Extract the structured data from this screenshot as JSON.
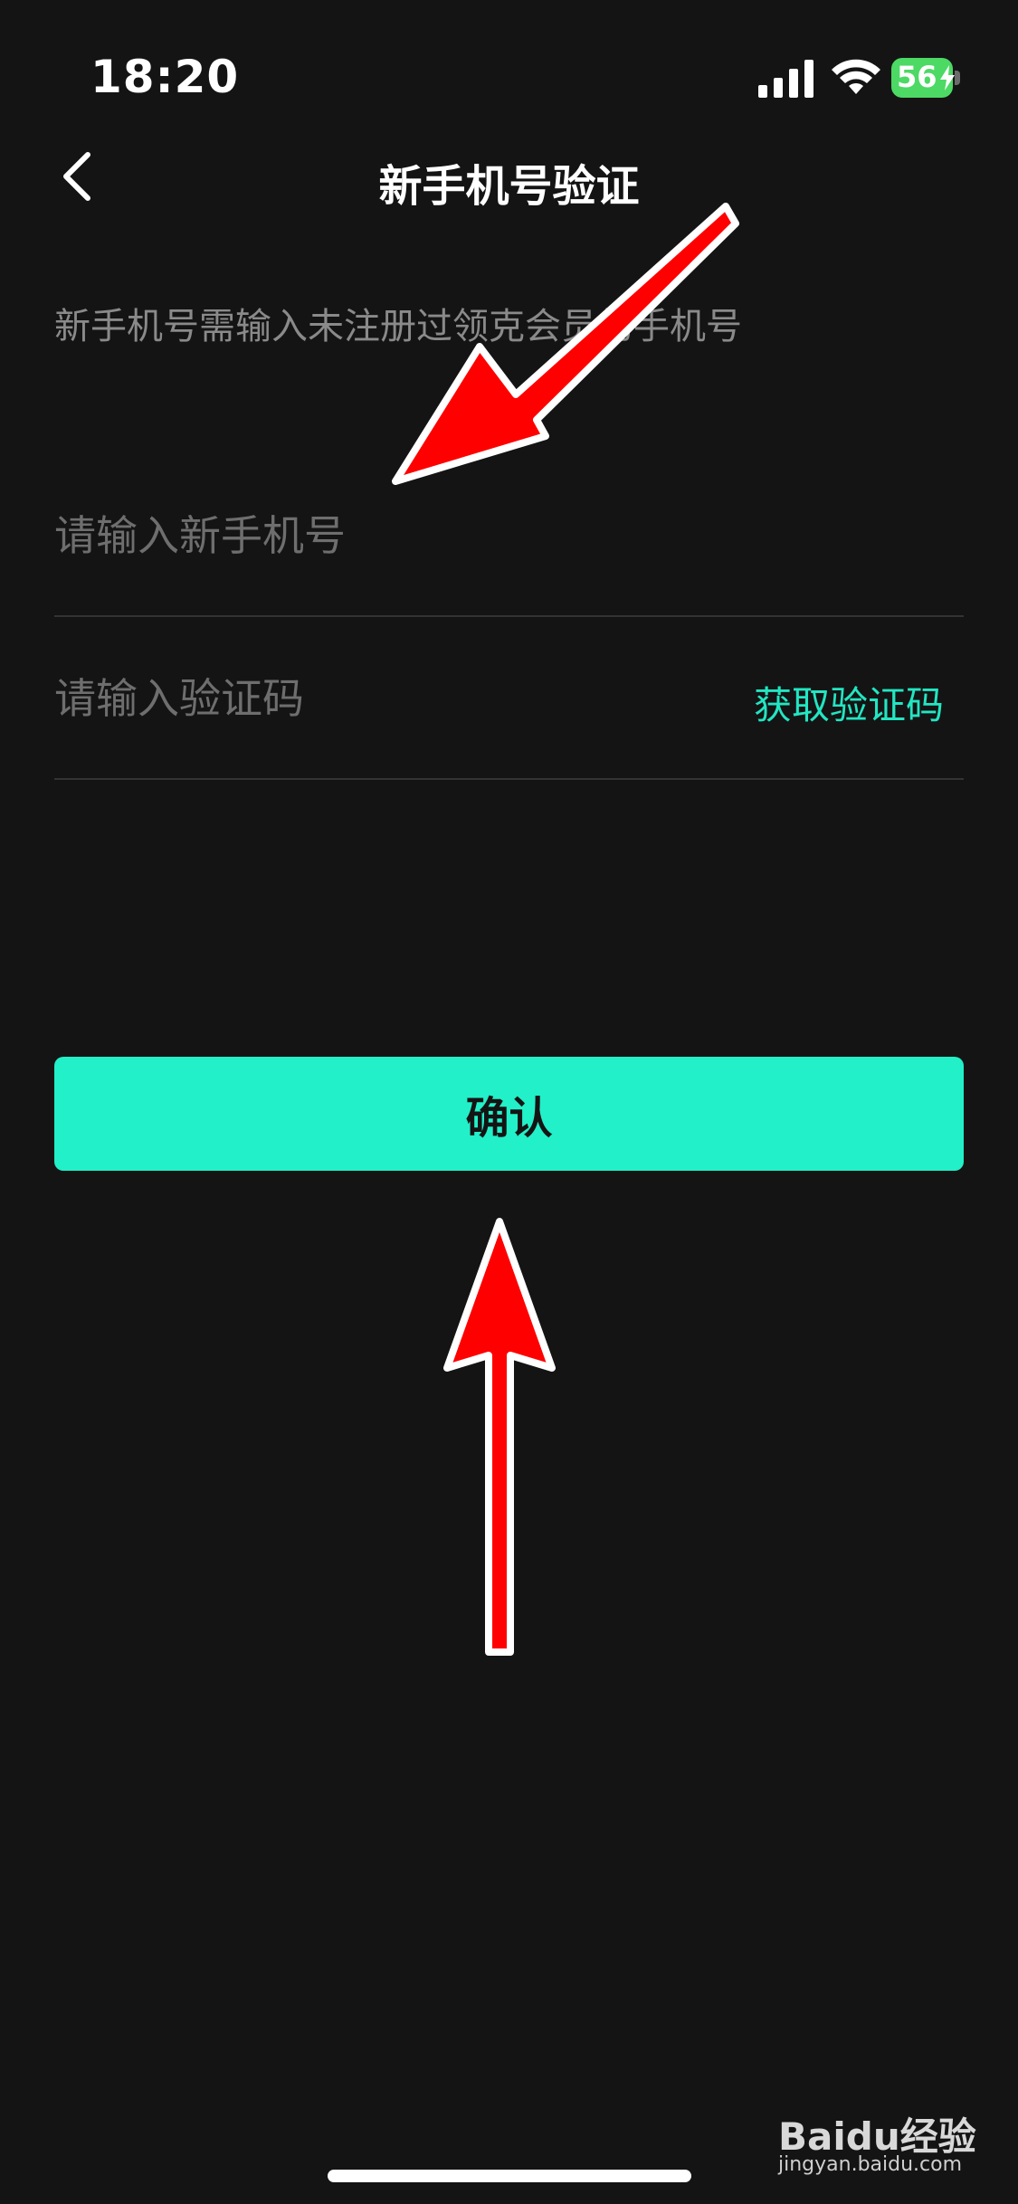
{
  "status_bar": {
    "time": "18:20",
    "battery_level": "56",
    "battery_color": "#4cd964"
  },
  "nav": {
    "back_icon": "chevron-left-icon",
    "title": "新手机号验证"
  },
  "hint": "新手机号需输入未注册过领克会员的手机号",
  "phone_field": {
    "value": "",
    "placeholder": "请输入新手机号"
  },
  "code_field": {
    "value": "",
    "placeholder": "请输入验证码",
    "get_code_label": "获取验证码"
  },
  "confirm_label": "确认",
  "colors": {
    "accent": "#22f0c8",
    "link": "#22e6c2",
    "background": "#141414",
    "annotation_arrow": "#ff0000"
  },
  "watermark": {
    "text": "Baidu经验",
    "subtext": "jingyan.baidu.com"
  }
}
